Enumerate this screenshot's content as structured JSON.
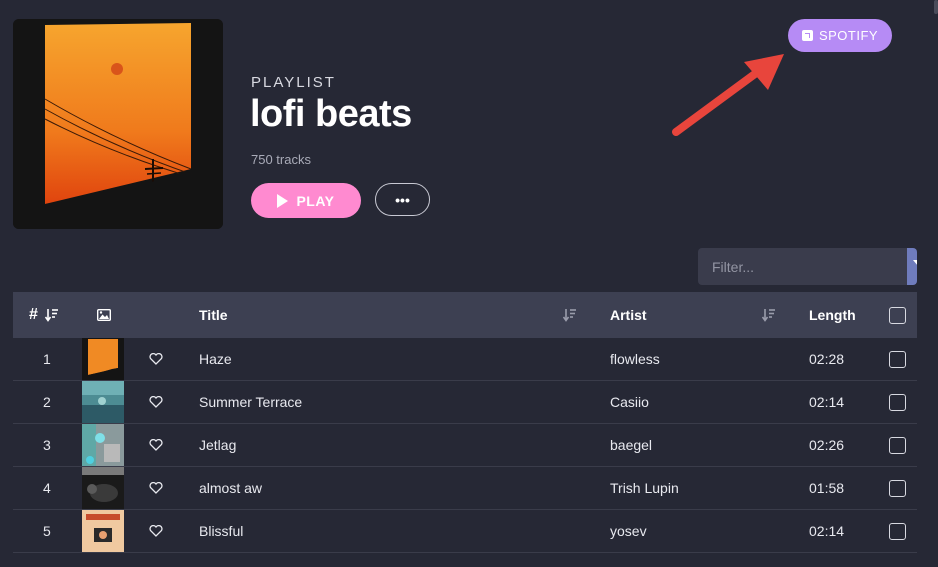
{
  "header": {
    "label": "PLAYLIST",
    "title": "lofi beats",
    "track_count": "750 tracks",
    "play_label": "PLAY",
    "more_label": "•••",
    "spotify_label": "SPOTIFY"
  },
  "filter": {
    "placeholder": "Filter..."
  },
  "table": {
    "columns": {
      "number": "#",
      "title": "Title",
      "artist": "Artist",
      "length": "Length"
    },
    "rows": [
      {
        "num": "1",
        "title": "Haze",
        "artist": "flowless",
        "length": "02:28"
      },
      {
        "num": "2",
        "title": "Summer Terrace",
        "artist": "Casiio",
        "length": "02:14"
      },
      {
        "num": "3",
        "title": "Jetlag",
        "artist": "baegel",
        "length": "02:26"
      },
      {
        "num": "4",
        "title": "almost aw",
        "artist": "Trish Lupin",
        "length": "01:58"
      },
      {
        "num": "5",
        "title": "Blissful",
        "artist": "yosev",
        "length": "02:14"
      }
    ]
  },
  "colors": {
    "background": "#262835",
    "play_button": "#ff8ad0",
    "spotify_button": "#b68bf5",
    "filter_button": "#6f7cbd",
    "table_header": "#3d4052",
    "annotation_arrow": "#e8453c"
  }
}
